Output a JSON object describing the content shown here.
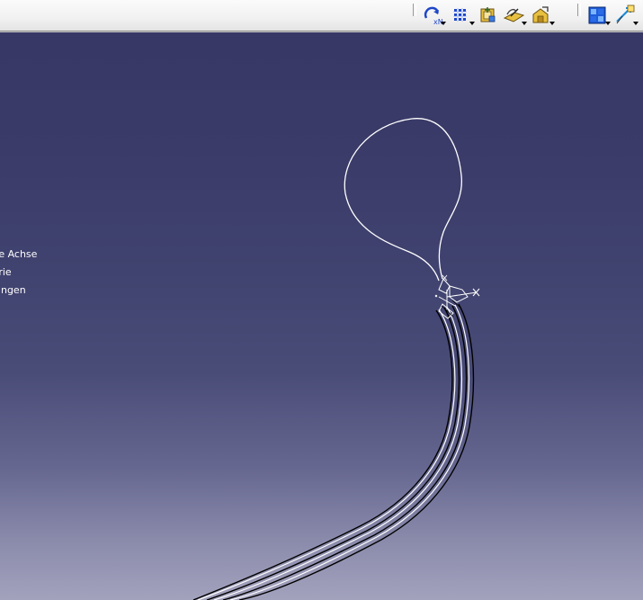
{
  "toolbar": {
    "buttons": [
      {
        "id": "xn",
        "label": "xN",
        "icon": "repeat-xn-icon"
      },
      {
        "id": "pattern",
        "icon": "grid-pattern-icon"
      },
      {
        "id": "b3",
        "icon": "part-body-icon"
      },
      {
        "id": "b4",
        "icon": "sheet-surface-icon"
      },
      {
        "id": "b5",
        "icon": "house-body-icon"
      },
      {
        "id": "b6",
        "icon": "blue-squares-icon"
      },
      {
        "id": "b7",
        "icon": "tangent-arrow-icon"
      }
    ]
  },
  "tree": {
    "items": [
      {
        "label": "te Achse"
      },
      {
        "label": "trie"
      },
      {
        "label": "ungen"
      }
    ]
  },
  "colors": {
    "background_top": "#373766",
    "background_bottom": "#a3a2bd",
    "geometry": "#ffffff",
    "geometry_outline": "#000000",
    "toolbar_bg": "#f1f1f1"
  }
}
